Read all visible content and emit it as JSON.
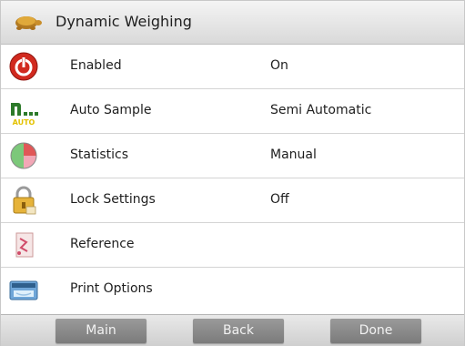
{
  "header": {
    "title": "Dynamic Weighing",
    "icon": "turtle-icon"
  },
  "rows": [
    {
      "label": "Enabled",
      "value": "On",
      "icon": "power-icon"
    },
    {
      "label": "Auto Sample",
      "value": "Semi Automatic",
      "icon": "auto-sample-icon",
      "icon_text": "AUTO"
    },
    {
      "label": "Statistics",
      "value": "Manual",
      "icon": "pie-chart-icon"
    },
    {
      "label": "Lock Settings",
      "value": "Off",
      "icon": "lock-icon"
    },
    {
      "label": "Reference",
      "value": "",
      "icon": "reference-icon"
    },
    {
      "label": "Print Options",
      "value": "",
      "icon": "printer-icon"
    }
  ],
  "footer": {
    "main_label": "Main",
    "back_label": "Back",
    "done_label": "Done"
  },
  "colors": {
    "accent_red": "#d12a1f",
    "auto_green": "#2d7a2a",
    "auto_yellow": "#e3c200",
    "button_gray": "#8a8a8a"
  }
}
